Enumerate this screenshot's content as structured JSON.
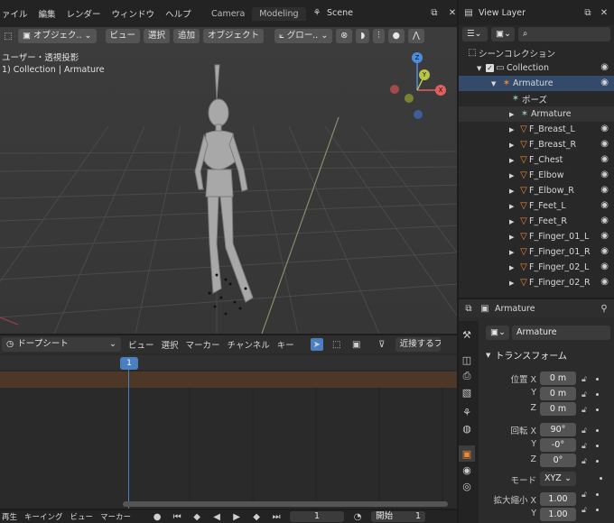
{
  "topbar": {
    "menus": [
      "ァイル",
      "編集",
      "レンダー",
      "ウィンドウ",
      "ヘルプ"
    ],
    "workspace_tabs": [
      "Camera",
      "Modeling"
    ],
    "scene_label": "Scene"
  },
  "viewport_header": {
    "mode": "オブジェク..",
    "menus": [
      "ビュー",
      "選択",
      "追加",
      "オブジェクト"
    ],
    "transform_orientation": "グロー.."
  },
  "viewport": {
    "view_name": "ユーザー・透視投影",
    "collection_info": "1) Collection | Armature",
    "gizmo_axes": {
      "x": "X",
      "y": "Y",
      "z": "Z"
    }
  },
  "dopesheet": {
    "mode": "ドープシート",
    "menus": [
      "ビュー",
      "選択",
      "マーカー",
      "チャンネル",
      "キー"
    ],
    "snap_label": "近接するフ",
    "current_frame": "1"
  },
  "timeline": {
    "menus": [
      "再生",
      "キーイング",
      "ビュー",
      "マーカー"
    ],
    "frame": "1",
    "start_label": "開始",
    "start_value": "1"
  },
  "outliner": {
    "view_layer": "View Layer",
    "search_placeholder": "",
    "scene_collection": "シーンコレクション",
    "collection": "Collection",
    "armature": "Armature",
    "pose": "ポーズ",
    "armature_data": "Armature",
    "bones": [
      "F_Breast_L",
      "F_Breast_R",
      "F_Chest",
      "F_Elbow",
      "F_Elbow_R",
      "F_Feet_L",
      "F_Feet_R",
      "F_Finger_01_L",
      "F_Finger_01_R",
      "F_Finger_02_L",
      "F_Finger_02_R"
    ]
  },
  "properties": {
    "object_name": "Armature",
    "object_field": "Armature",
    "section_title": "トランスフォーム",
    "location_label": "位置 X",
    "y_label": "Y",
    "z_label": "Z",
    "location": [
      "0 m",
      "0 m",
      "0 m"
    ],
    "rotation_label": "回転 X",
    "rotation": [
      "90°",
      "-0°",
      "0°"
    ],
    "mode_label": "モード",
    "mode_value": "XYZ",
    "scale_label": "拡大縮小 X",
    "scale": [
      "1.00",
      "1.00"
    ]
  },
  "colors": {
    "accent_blue": "#4a7fc1",
    "bone_orange": "#f08a2c",
    "axis_x": "#e06060",
    "axis_y": "#b8c34a",
    "axis_z": "#4d8de0"
  }
}
